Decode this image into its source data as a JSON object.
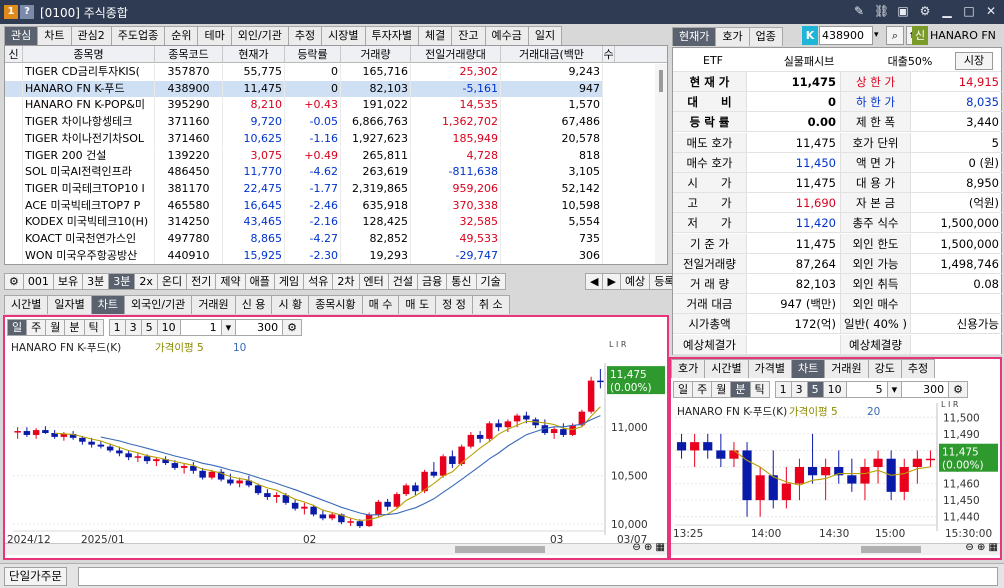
{
  "window": {
    "title": "[0100] 주식종합",
    "badge1": "1",
    "badge2": "?"
  },
  "watchlist": {
    "tabs": [
      "관심",
      "차트",
      "관심2",
      "주도업종",
      "순위",
      "테마",
      "외인/기관",
      "추정",
      "시장별",
      "투자자별",
      "체결",
      "잔고",
      "예수금",
      "일지"
    ],
    "active_tab": 0,
    "headers": [
      "신",
      "종목명",
      "종목코드",
      "현재가",
      "등락률",
      "거래량",
      "전일거래량대",
      "거래대금(백만",
      "수"
    ],
    "rows": [
      {
        "name": "TIGER CD금리투자KIS(",
        "code": "357870",
        "price": "55,775",
        "chg": "0",
        "vol": "165,716",
        "prev": "25,302",
        "amt": "9,243",
        "dir": "bk"
      },
      {
        "name": "HANARO FN K-푸드",
        "code": "438900",
        "price": "11,475",
        "chg": "0",
        "vol": "82,103",
        "prev": "-5,161",
        "amt": "947",
        "dir": "bk",
        "sel": true
      },
      {
        "name": "HANARO FN K-POP&미",
        "code": "395290",
        "price": "8,210",
        "chg": "+0.43",
        "vol": "191,022",
        "prev": "14,535",
        "amt": "1,570",
        "dir": "up"
      },
      {
        "name": "TIGER 차이나항셍테크",
        "code": "371160",
        "price": "9,720",
        "chg": "-0.05",
        "vol": "6,866,763",
        "prev": "1,362,702",
        "amt": "67,486",
        "dir": "dn"
      },
      {
        "name": "TIGER 차이나전기차SOL",
        "code": "371460",
        "price": "10,625",
        "chg": "-1.16",
        "vol": "1,927,623",
        "prev": "185,949",
        "amt": "20,578",
        "dir": "dn"
      },
      {
        "name": "TIGER 200 건설",
        "code": "139220",
        "price": "3,075",
        "chg": "+0.49",
        "vol": "265,811",
        "prev": "4,728",
        "amt": "818",
        "dir": "up"
      },
      {
        "name": "SOL 미국AI전력인프라",
        "code": "486450",
        "price": "11,770",
        "chg": "-4.62",
        "vol": "263,619",
        "prev": "-811,638",
        "amt": "3,105",
        "dir": "dn"
      },
      {
        "name": "TIGER 미국테크TOP10 I",
        "code": "381170",
        "price": "22,475",
        "chg": "-1.77",
        "vol": "2,319,865",
        "prev": "959,206",
        "amt": "52,142",
        "dir": "dn"
      },
      {
        "name": "ACE 미국빅테크TOP7 P",
        "code": "465580",
        "price": "16,645",
        "chg": "-2.46",
        "vol": "635,918",
        "prev": "370,338",
        "amt": "10,598",
        "dir": "dn"
      },
      {
        "name": "KODEX 미국빅테크10(H)",
        "code": "314250",
        "price": "43,465",
        "chg": "-2.16",
        "vol": "128,425",
        "prev": "32,585",
        "amt": "5,554",
        "dir": "dn"
      },
      {
        "name": "KOACT 미국천연가스인",
        "code": "497780",
        "price": "8,865",
        "chg": "-4.27",
        "vol": "82,852",
        "prev": "49,533",
        "amt": "735",
        "dir": "dn"
      },
      {
        "name": "WON 미국우주항공방산",
        "code": "440910",
        "price": "15,925",
        "chg": "-2.30",
        "vol": "19,293",
        "prev": "-29,747",
        "amt": "306",
        "dir": "dn"
      }
    ]
  },
  "group_bar": {
    "gear": "⚙",
    "items": [
      "001",
      "보유",
      "3분",
      "3분",
      "2x",
      "온디",
      "전기",
      "제약",
      "애플",
      "게임",
      "석유",
      "2차",
      "엔터",
      "건설",
      "금융",
      "통신",
      "기술"
    ],
    "active_index": 3,
    "right": [
      "예상",
      "등록"
    ]
  },
  "chart_tabs": [
    "시간별",
    "일자별",
    "차트",
    "외국인/기관",
    "거래원",
    "신 용",
    "시 황",
    "종목시황",
    "매 수",
    "매 도",
    "정 정",
    "취 소"
  ],
  "chart_tabs_active": 2,
  "main_chart": {
    "periods": [
      "일",
      "주",
      "월",
      "분",
      "틱"
    ],
    "active_period": 0,
    "nums": [
      "1",
      "3",
      "5",
      "10"
    ],
    "combo1": "1",
    "count": "300",
    "legend_name": "HANARO FN K-푸드(K)",
    "legend_ma": "가격이평 5",
    "legend_ma2": "10",
    "last_price_box": "11,475",
    "last_pct_box": "(0.00%)",
    "lr_badge": "L I R",
    "y_ticks": [
      "11,000",
      "10,500",
      "10,000"
    ],
    "x_labels": [
      "2024/12",
      "2025/01",
      "02",
      "03",
      "03/07"
    ]
  },
  "quote": {
    "tabs": [
      "현재가",
      "호가",
      "업종"
    ],
    "active_tab": 0,
    "code": "438900",
    "stock_name": "HANARO FN",
    "sin_badge": "신",
    "k_badge": "K",
    "etf_row": {
      "a": "ETF",
      "b": "실물패시브",
      "c": "대출50%",
      "btn": "시장"
    },
    "left": [
      {
        "l": "현 재 가",
        "v": "11,475",
        "bold": true
      },
      {
        "l": "대　　비",
        "v": "0",
        "bold": true
      },
      {
        "l": "등 락 률",
        "v": "0.00",
        "bold": true
      },
      {
        "l": "매도 호가",
        "v": "11,475"
      },
      {
        "l": "매수 호가",
        "v": "11,450",
        "cls": "dn"
      },
      {
        "l": "시　　가",
        "v": "11,475"
      },
      {
        "l": "고　　가",
        "v": "11,690",
        "cls": "up"
      },
      {
        "l": "저　　가",
        "v": "11,420",
        "cls": "dn"
      },
      {
        "l": "기 준 가",
        "v": "11,475"
      },
      {
        "l": "전일거래량",
        "v": "87,264"
      },
      {
        "l": "거 래 량",
        "v": "82,103"
      },
      {
        "l": "거래 대금",
        "v": "947 (백만)"
      },
      {
        "l": "시가총액",
        "v": "172(억)"
      },
      {
        "l": "예상체결가",
        "v": ""
      }
    ],
    "right": [
      {
        "l": "상 한 가",
        "v": "14,915",
        "lcls": "up",
        "cls": "up"
      },
      {
        "l": "하 한 가",
        "v": "8,035",
        "lcls": "dn",
        "cls": "dn"
      },
      {
        "l": "제 한 폭",
        "v": "3,440"
      },
      {
        "l": "호가 단위",
        "v": "5"
      },
      {
        "l": "액 면 가",
        "v": "0 (원)"
      },
      {
        "l": "대 용 가",
        "v": "8,950"
      },
      {
        "l": "자 본 금",
        "v": "(억원)"
      },
      {
        "l": "총주 식수",
        "v": "1,500,000"
      },
      {
        "l": "외인 한도",
        "v": "1,500,000"
      },
      {
        "l": "외인 가능",
        "v": "1,498,746"
      },
      {
        "l": "외인 취득",
        "v": "0.08"
      },
      {
        "l": "외인 매수",
        "v": ""
      },
      {
        "l": "일반( 40% )",
        "v": "신용가능"
      },
      {
        "l": "예상체결량",
        "v": ""
      }
    ]
  },
  "mini_chart": {
    "tabs": [
      "호가",
      "시간별",
      "가격별",
      "차트",
      "거래원",
      "강도",
      "추정"
    ],
    "active_tab": 3,
    "periods": [
      "일",
      "주",
      "월",
      "분",
      "틱"
    ],
    "active_period": 3,
    "nums": [
      "1",
      "3",
      "5",
      "10"
    ],
    "active_num": 2,
    "combo1": "5",
    "count": "300",
    "legend_name": "HANARO FN K-푸드(K)",
    "legend_ma": "가격이평 5",
    "legend_ma2": "20",
    "last_price_box": "11,475",
    "last_pct_box": "(0.00%)",
    "lr_badge": "L I R",
    "y_ticks": [
      "11,500",
      "11,490",
      "11,480",
      "11,470",
      "11,460",
      "11,450",
      "11,440"
    ],
    "x_labels": [
      "13:25",
      "14:00",
      "14:30",
      "15:00",
      "15:30:00"
    ]
  },
  "statusbar": {
    "button": "단일가주문"
  },
  "chart_data": [
    {
      "type": "candlestick",
      "x_start": "2024/12",
      "x_end": "2025/03/07",
      "ylim": [
        9950,
        11600
      ],
      "candles": [
        [
          10950,
          11000,
          10880,
          10960
        ],
        [
          10960,
          11000,
          10900,
          10920
        ],
        [
          10920,
          10990,
          10880,
          10970
        ],
        [
          10970,
          11010,
          10930,
          10940
        ],
        [
          10940,
          10970,
          10880,
          10900
        ],
        [
          10900,
          10950,
          10860,
          10930
        ],
        [
          10930,
          10960,
          10870,
          10890
        ],
        [
          10890,
          10910,
          10820,
          10850
        ],
        [
          10850,
          10890,
          10790,
          10820
        ],
        [
          10820,
          10860,
          10780,
          10800
        ],
        [
          10800,
          10830,
          10740,
          10760
        ],
        [
          10760,
          10800,
          10700,
          10730
        ],
        [
          10730,
          10760,
          10660,
          10690
        ],
        [
          10690,
          10730,
          10640,
          10700
        ],
        [
          10700,
          10720,
          10620,
          10650
        ],
        [
          10650,
          10690,
          10600,
          10670
        ],
        [
          10670,
          10700,
          10610,
          10630
        ],
        [
          10630,
          10660,
          10560,
          10580
        ],
        [
          10580,
          10620,
          10520,
          10600
        ],
        [
          10600,
          10640,
          10520,
          10550
        ],
        [
          10550,
          10580,
          10460,
          10480
        ],
        [
          10480,
          10560,
          10460,
          10540
        ],
        [
          10540,
          10570,
          10440,
          10460
        ],
        [
          10460,
          10520,
          10400,
          10420
        ],
        [
          10420,
          10480,
          10380,
          10450
        ],
        [
          10450,
          10500,
          10380,
          10400
        ],
        [
          10400,
          10420,
          10300,
          10320
        ],
        [
          10320,
          10360,
          10250,
          10280
        ],
        [
          10280,
          10330,
          10220,
          10300
        ],
        [
          10300,
          10320,
          10200,
          10220
        ],
        [
          10220,
          10260,
          10140,
          10160
        ],
        [
          10160,
          10220,
          10100,
          10180
        ],
        [
          10180,
          10200,
          10080,
          10100
        ],
        [
          10100,
          10140,
          10040,
          10060
        ],
        [
          10060,
          10120,
          10040,
          10100
        ],
        [
          10100,
          10110,
          10000,
          10020
        ],
        [
          10020,
          10060,
          9980,
          10030
        ],
        [
          10030,
          10050,
          9960,
          9980
        ],
        [
          9980,
          10120,
          9970,
          10100
        ],
        [
          10100,
          10250,
          10080,
          10230
        ],
        [
          10230,
          10260,
          10140,
          10180
        ],
        [
          10180,
          10330,
          10160,
          10310
        ],
        [
          10310,
          10420,
          10290,
          10400
        ],
        [
          10400,
          10430,
          10300,
          10340
        ],
        [
          10340,
          10560,
          10320,
          10540
        ],
        [
          10540,
          10640,
          10480,
          10500
        ],
        [
          10500,
          10720,
          10480,
          10700
        ],
        [
          10700,
          10760,
          10580,
          10620
        ],
        [
          10620,
          10820,
          10600,
          10800
        ],
        [
          10800,
          10950,
          10780,
          10920
        ],
        [
          10920,
          10960,
          10840,
          10880
        ],
        [
          10880,
          11060,
          10860,
          11040
        ],
        [
          11040,
          11080,
          10960,
          11000
        ],
        [
          11000,
          11080,
          10950,
          11060
        ],
        [
          11060,
          11140,
          11000,
          11120
        ],
        [
          11120,
          11160,
          11040,
          11080
        ],
        [
          11080,
          11100,
          10990,
          11020
        ],
        [
          11020,
          11080,
          10920,
          10940
        ],
        [
          10940,
          11000,
          10880,
          10980
        ],
        [
          10980,
          11040,
          10900,
          10920
        ],
        [
          10920,
          11040,
          10910,
          11020
        ],
        [
          11020,
          11180,
          11000,
          11160
        ],
        [
          11160,
          11520,
          11140,
          11480
        ],
        [
          11480,
          11600,
          11400,
          11475
        ]
      ],
      "ma5_label": "가격이평 5",
      "ma10_label": "10"
    },
    {
      "type": "candlestick",
      "x_start": "13:25",
      "x_end": "15:30:00",
      "ylim": [
        11435,
        11505
      ],
      "candles": [
        [
          11485,
          11490,
          11475,
          11480
        ],
        [
          11480,
          11490,
          11470,
          11485
        ],
        [
          11485,
          11490,
          11475,
          11480
        ],
        [
          11480,
          11490,
          11470,
          11475
        ],
        [
          11475,
          11485,
          11470,
          11480
        ],
        [
          11480,
          11485,
          11440,
          11450
        ],
        [
          11450,
          11470,
          11440,
          11465
        ],
        [
          11465,
          11480,
          11445,
          11450
        ],
        [
          11450,
          11470,
          11445,
          11460
        ],
        [
          11460,
          11475,
          11450,
          11470
        ],
        [
          11470,
          11490,
          11460,
          11465
        ],
        [
          11465,
          11475,
          11450,
          11470
        ],
        [
          11470,
          11480,
          11460,
          11465
        ],
        [
          11465,
          11475,
          11455,
          11460
        ],
        [
          11460,
          11475,
          11450,
          11470
        ],
        [
          11470,
          11480,
          11460,
          11475
        ],
        [
          11475,
          11480,
          11450,
          11455
        ],
        [
          11455,
          11475,
          11450,
          11470
        ],
        [
          11470,
          11480,
          11460,
          11475
        ],
        [
          11475,
          11480,
          11470,
          11475
        ]
      ],
      "ma5_label": "가격이평 5",
      "ma20_label": "20"
    }
  ]
}
